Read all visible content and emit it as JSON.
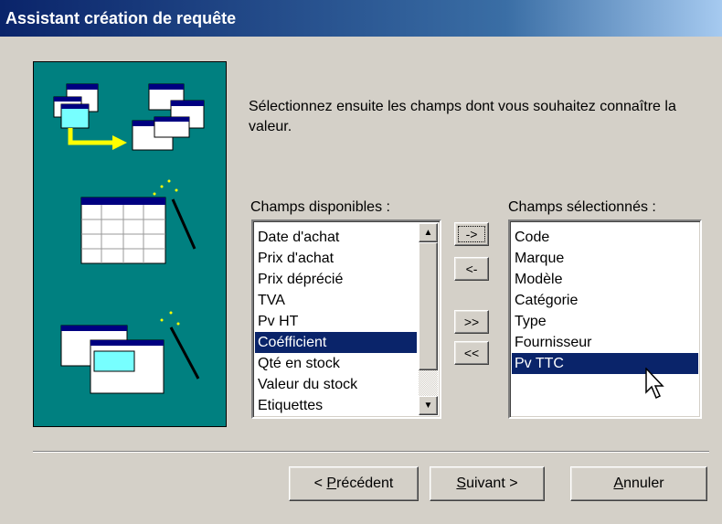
{
  "window": {
    "title": "Assistant création de requête"
  },
  "instruction": "Sélectionnez ensuite les champs dont vous souhaitez connaître la valeur.",
  "available": {
    "label": "Champs disponibles :",
    "items": [
      "Date d'achat",
      "Prix d'achat",
      "Prix déprécié",
      "TVA",
      "Pv HT",
      "Coéfficient",
      "Qté en stock",
      "Valeur du stock",
      "Etiquettes"
    ],
    "selected_index": 5
  },
  "selected": {
    "label": "Champs sélectionnés :",
    "items": [
      "Code",
      "Marque",
      "Modèle",
      "Catégorie",
      "Type",
      "Fournisseur",
      "Pv TTC"
    ],
    "selected_index": 6
  },
  "transfer": {
    "add_one": "->",
    "remove_one": "<-",
    "add_all": ">>",
    "remove_all": "<<"
  },
  "footer": {
    "back": {
      "mnemonic": "P",
      "rest": "récédent",
      "prefix": "< "
    },
    "next": {
      "mnemonic": "S",
      "rest": "uivant",
      "suffix": " >"
    },
    "cancel": {
      "mnemonic": "A",
      "rest": "nnuler"
    }
  },
  "colors": {
    "teal_panel": "#008080",
    "selection": "#0a246a",
    "title_gradient_start": "#0a246a"
  }
}
